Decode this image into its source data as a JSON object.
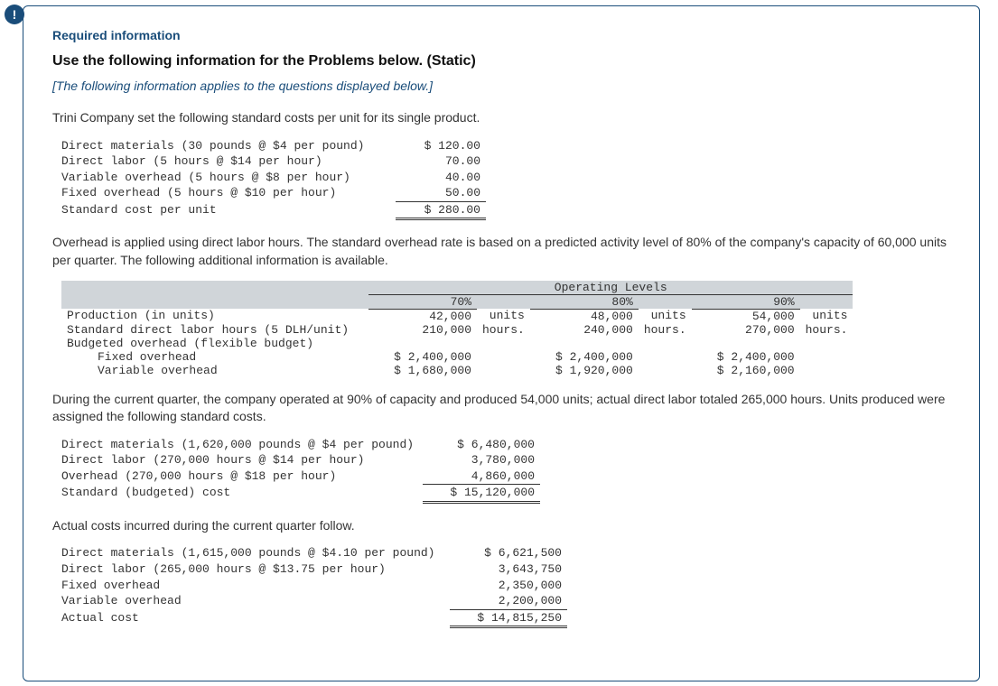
{
  "badge": "!",
  "header": {
    "required": "Required information",
    "title": "Use the following information for the Problems below. (Static)",
    "note": "[The following information applies to the questions displayed below.]"
  },
  "intro": "Trini Company set the following standard costs per unit for its single product.",
  "costs": {
    "rows": [
      {
        "label": "Direct materials (30 pounds @ $4 per pound)",
        "value": "$ 120.00"
      },
      {
        "label": "Direct labor (5 hours @ $14 per hour)",
        "value": "70.00"
      },
      {
        "label": "Variable overhead (5 hours @ $8 per hour)",
        "value": "40.00"
      },
      {
        "label": "Fixed overhead (5 hours @ $10 per hour)",
        "value": "50.00"
      }
    ],
    "total": {
      "label": "Standard cost per unit",
      "value": "$ 280.00"
    }
  },
  "overhead_para": "Overhead is applied using direct labor hours. The standard overhead rate is based on a predicted activity level of 80% of the company's capacity of 60,000 units per quarter. The following additional information is available.",
  "op_table": {
    "header": "Operating Levels",
    "levels": [
      "70%",
      "80%",
      "90%"
    ],
    "rows": [
      {
        "label": "Production (in units)",
        "vals": [
          "42,000",
          "48,000",
          "54,000"
        ],
        "unit": "units"
      },
      {
        "label": "Standard direct labor hours (5 DLH/unit)",
        "vals": [
          "210,000",
          "240,000",
          "270,000"
        ],
        "unit": "hours."
      },
      {
        "label": "Budgeted overhead (flexible budget)",
        "vals": [
          "",
          "",
          ""
        ],
        "unit": ""
      },
      {
        "label": "Fixed overhead",
        "indent": true,
        "vals": [
          "$ 2,400,000",
          "$ 2,400,000",
          "$ 2,400,000"
        ],
        "unit": ""
      },
      {
        "label": "Variable overhead",
        "indent": true,
        "vals": [
          "$ 1,680,000",
          "$ 1,920,000",
          "$ 2,160,000"
        ],
        "unit": ""
      }
    ]
  },
  "during_para": "During the current quarter, the company operated at 90% of capacity and produced 54,000 units; actual direct labor totaled 265,000 hours. Units produced were assigned the following standard costs.",
  "standard_costs": {
    "rows": [
      {
        "label": "Direct materials (1,620,000 pounds @ $4 per pound)",
        "value": "$ 6,480,000"
      },
      {
        "label": "Direct labor (270,000 hours @ $14 per hour)",
        "value": "3,780,000"
      },
      {
        "label": "Overhead (270,000 hours @ $18 per hour)",
        "value": "4,860,000"
      }
    ],
    "total": {
      "label": "Standard (budgeted) cost",
      "value": "$ 15,120,000"
    }
  },
  "actual_para": "Actual costs incurred during the current quarter follow.",
  "actual_costs": {
    "rows": [
      {
        "label": "Direct materials (1,615,000 pounds @ $4.10 per pound)",
        "value": "$ 6,621,500"
      },
      {
        "label": "Direct labor (265,000 hours @ $13.75 per hour)",
        "value": "3,643,750"
      },
      {
        "label": "Fixed overhead",
        "value": "2,350,000"
      },
      {
        "label": "Variable overhead",
        "value": "2,200,000"
      }
    ],
    "total": {
      "label": "Actual cost",
      "value": "$ 14,815,250"
    }
  }
}
